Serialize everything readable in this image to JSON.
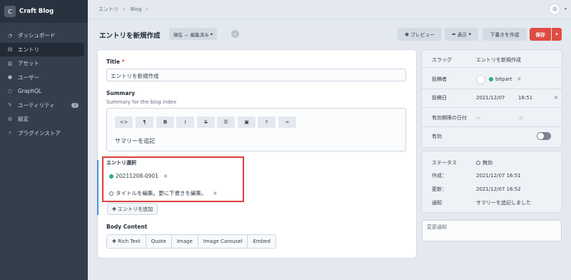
{
  "sidebar": {
    "site_badge": "C",
    "site_name": "Craft Blog",
    "items": [
      {
        "label": "ダッシュボード",
        "icon": "dashboard-icon"
      },
      {
        "label": "エントリ",
        "icon": "entries-icon"
      },
      {
        "label": "アセット",
        "icon": "assets-icon"
      },
      {
        "label": "ユーザー",
        "icon": "users-icon"
      },
      {
        "label": "GraphQL",
        "icon": "graphql-icon"
      },
      {
        "label": "ユーティリティ",
        "icon": "utilities-icon",
        "badge": "3"
      },
      {
        "label": "設定",
        "icon": "settings-icon"
      },
      {
        "label": "プラグインストア",
        "icon": "plugin-store-icon"
      }
    ]
  },
  "breadcrumbs": [
    "エントリ",
    "Blog"
  ],
  "header": {
    "title": "エントリを新規作成",
    "revision": "現在 — 編集済み",
    "preview": "プレビュー",
    "view": "表示",
    "save_draft": "下書きを作成",
    "save": "保存"
  },
  "fields": {
    "title_label": "Title",
    "title_value": "エントリを新規作成",
    "summary_label": "Summary",
    "summary_instructions": "Summary for the blog index",
    "summary_text": "サマリーを追記",
    "toolbar": [
      "<>",
      "¶",
      "B",
      "I",
      "S",
      "☰",
      "▣",
      "⇪",
      "∞"
    ],
    "entries_label": "エントリ選択",
    "entries": [
      {
        "title": "20211208-0901",
        "status": "live"
      },
      {
        "title": "タイトルを編集。更に下書きを編集。",
        "status": "draft"
      }
    ],
    "add_entry": "エントリを追加",
    "body_label": "Body Content",
    "block_types": [
      "Rich Text",
      "Quote",
      "Image",
      "Image Carousel",
      "Embed"
    ]
  },
  "meta": {
    "slug_label": "スラッグ",
    "slug_value": "エントリを新規作成",
    "author_label": "投稿者",
    "author_value": "bitpart",
    "post_date_label": "投稿日",
    "post_date": "2021/12/07",
    "post_time": "16:51",
    "expiry_label": "有効期限の日付",
    "enabled_label": "有効",
    "enabled": false
  },
  "status": {
    "status_label": "ステータス",
    "status_value": "無効",
    "created_label": "作成：",
    "created_value": "2021/12/07 16:51",
    "updated_label": "更新：",
    "updated_value": "2021/12/07 16:52",
    "notes_label": "通知",
    "notes_value": "サマリーを追記しました"
  },
  "notes_placeholder": "変更通知",
  "colors": {
    "accent": "#df4c43",
    "sidebar": "#333f4d",
    "highlight": "#df3d3d"
  }
}
